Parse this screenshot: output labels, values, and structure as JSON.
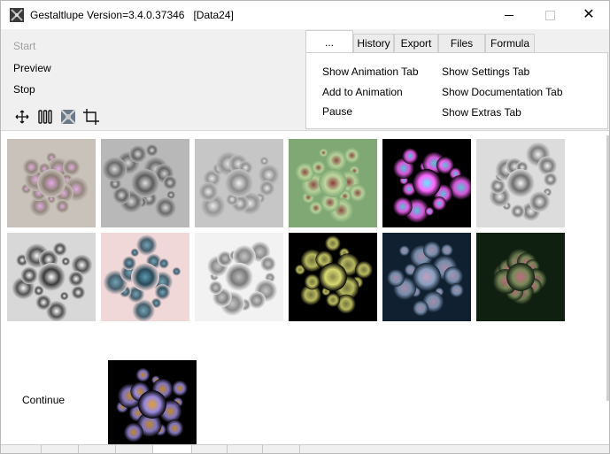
{
  "window": {
    "title": "Gestaltlupe Version=3.4.0.37346   [Data24]",
    "app_icon": "fractal-app-icon",
    "controls": {
      "minimize_icon": "minimize-icon",
      "maximize_icon": "maximize-icon",
      "close_glyph": "✕"
    }
  },
  "sidebar": {
    "start_label": "Start",
    "preview_label": "Preview",
    "stop_label": "Stop",
    "tool_icons": [
      "move-icon",
      "sliders-icon",
      "reset-view-icon",
      "crop-icon"
    ]
  },
  "tabs": [
    {
      "label": "...",
      "active": true
    },
    {
      "label": "History",
      "active": false
    },
    {
      "label": "Export",
      "active": false
    },
    {
      "label": "Files",
      "active": false
    },
    {
      "label": "Formula",
      "active": false
    }
  ],
  "panel": {
    "show_animation_tab": "Show Animation Tab",
    "add_to_animation": "Add to Animation",
    "pause": "Pause",
    "show_settings_tab": "Show Settings Tab",
    "show_documentation_tab": "Show Documentation Tab",
    "show_extras_tab": "Show Extras Tab"
  },
  "gallery": {
    "thumbnails": [
      {
        "name": "thumb-1",
        "palette": [
          "#c9c2bb",
          "#8b7e74",
          "#e6a9e6"
        ]
      },
      {
        "name": "thumb-2",
        "palette": [
          "#b8b8b8",
          "#5d5d5d",
          "#e0e0e0"
        ]
      },
      {
        "name": "thumb-3",
        "palette": [
          "#c6c6c6",
          "#8c8c8c",
          "#f0f0f0"
        ]
      },
      {
        "name": "thumb-4",
        "palette": [
          "#7fa874",
          "#c0d8a0",
          "#8c3a3a"
        ]
      },
      {
        "name": "thumb-5",
        "palette": [
          "#000000",
          "#ff66ff",
          "#66e6ff"
        ]
      },
      {
        "name": "thumb-6",
        "palette": [
          "#dcdcdc",
          "#6e6e6e",
          "#f5f5f5"
        ]
      },
      {
        "name": "thumb-7",
        "palette": [
          "#d8d8d8",
          "#3a3a3a",
          "#ffffff"
        ]
      },
      {
        "name": "thumb-8",
        "palette": [
          "#f0d8d8",
          "#2a4a5a",
          "#5a9ab0"
        ]
      },
      {
        "name": "thumb-9",
        "palette": [
          "#f2f2f2",
          "#7a7a7a",
          "#bdbdbd"
        ]
      },
      {
        "name": "thumb-10",
        "palette": [
          "#000000",
          "#d8d870",
          "#8a8a4a"
        ]
      },
      {
        "name": "thumb-11",
        "palette": [
          "#102030",
          "#8aa0c0",
          "#c0a0c0"
        ]
      },
      {
        "name": "thumb-12",
        "palette": [
          "#102010",
          "#7a8a5a",
          "#c06a80"
        ]
      },
      {
        "name": "thumb-continue",
        "palette": [
          "#000000",
          "#9a8ae0",
          "#e0a030"
        ]
      }
    ],
    "continue_label": "Continue"
  },
  "bottom_tabs": {
    "count": 8,
    "selected_index": 4
  }
}
